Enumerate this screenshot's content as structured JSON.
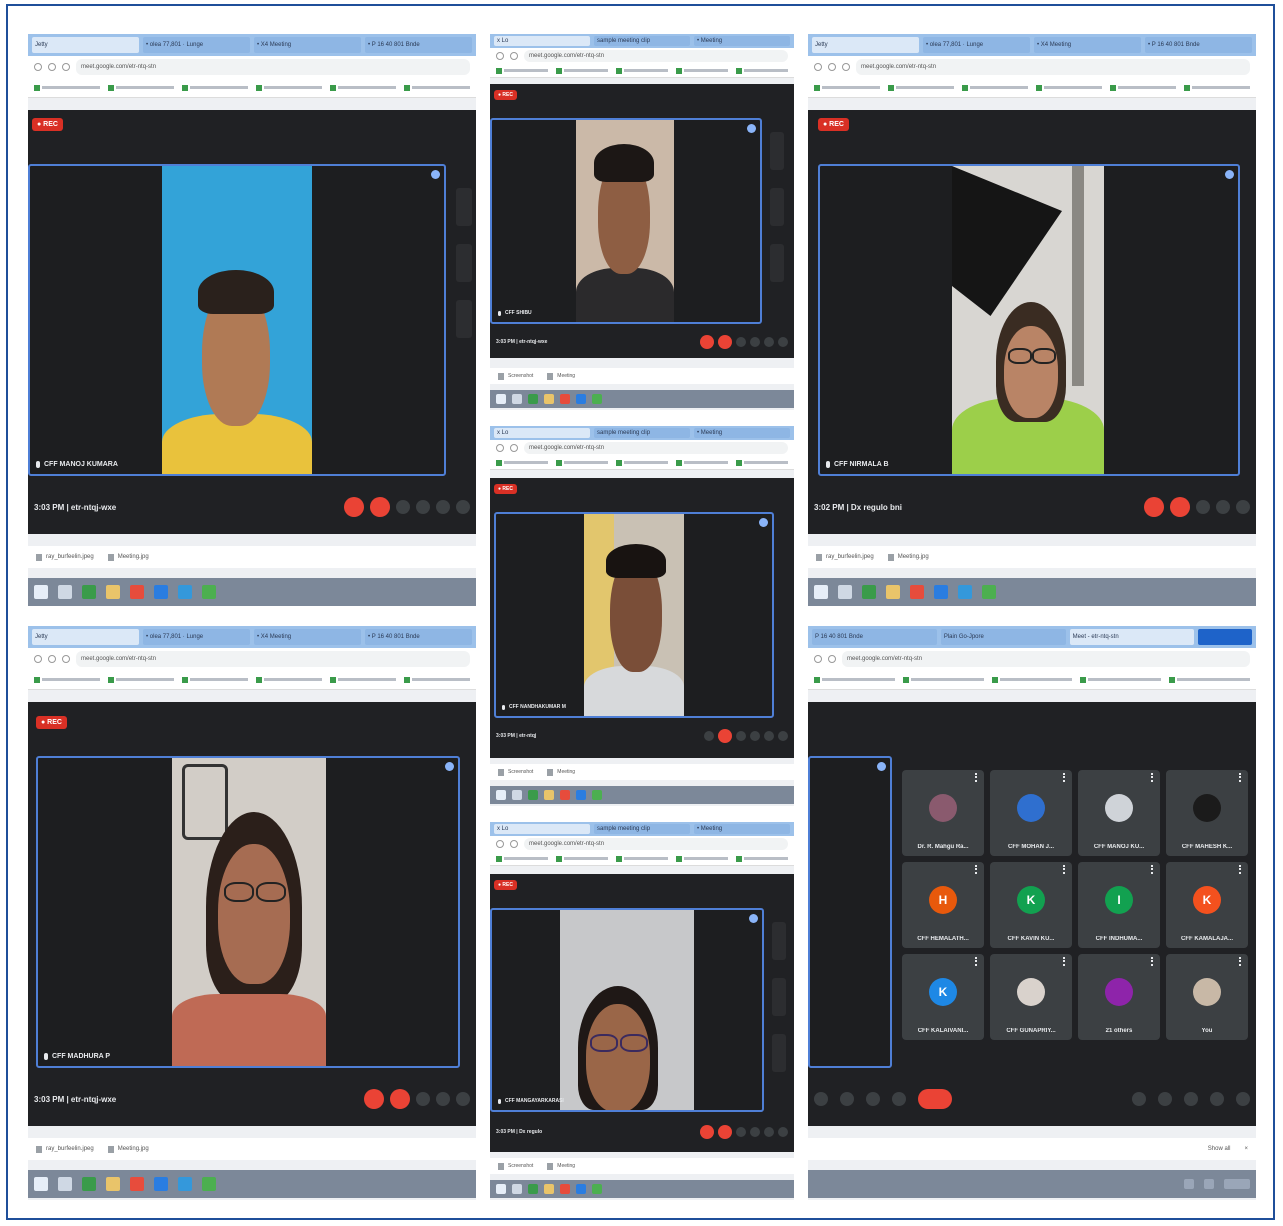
{
  "colors": {
    "border": "#1f4f9a",
    "meet_bg": "#202124",
    "tile_border": "#4f7fd6",
    "rec": "#d93025",
    "end_call": "#ea4335",
    "tab_bar": "#9cc1ea",
    "taskbar": "#7c8899"
  },
  "screenshots": [
    {
      "id": "shot-1",
      "tabs": [
        "Jetty",
        "• olea 77,801 · Lunge",
        "• X4 Meeting",
        "• P 16 40 801 Bnde"
      ],
      "url": "meet.google.com/etr-ntq-stn",
      "rec_label": "● REC",
      "participant": "CFF MANOJ KUMARA",
      "clock": "3:03 PM  |  etr-ntqj-wxe",
      "downloads": [
        "ray_burfeelin.jpeg",
        "Meeting.jpg"
      ]
    },
    {
      "id": "shot-2",
      "tabs": [
        "x Lo",
        "sample meeting clip",
        "• Meeting"
      ],
      "url": "meet.google.com/etr-ntq-stn",
      "rec_label": "● REC",
      "participant": "CFF SHIBU",
      "clock": "3:03 PM  |  etr-ntqj-wxe",
      "downloads": [
        "Screenshot",
        "Meeting"
      ]
    },
    {
      "id": "shot-3",
      "tabs": [
        "Jetty",
        "• olea 77,801 · Lunge",
        "• X4 Meeting",
        "• P 16 40 801 Bnde"
      ],
      "url": "meet.google.com/etr-ntq-stn",
      "rec_label": "● REC",
      "participant": "CFF NIRMALA B",
      "clock": "3:02 PM  |  Dx regulo bni",
      "downloads": [
        "ray_burfeelin.jpeg",
        "Meeting.jpg"
      ]
    },
    {
      "id": "shot-4",
      "tabs": [
        "x Lo",
        "sample meeting clip",
        "• Meeting"
      ],
      "url": "meet.google.com/etr-ntq-stn",
      "rec_label": "● REC",
      "participant": "CFF NANDHAKUMAR M",
      "clock": "3:03 PM  |  etr-ntqj",
      "downloads": [
        "Screenshot",
        "Meeting"
      ]
    },
    {
      "id": "shot-5",
      "tabs": [
        "Jetty",
        "• olea 77,801 · Lunge",
        "• X4 Meeting",
        "• P 16 40 801 Bnde"
      ],
      "url": "meet.google.com/etr-ntq-stn",
      "rec_label": "● REC",
      "participant": "CFF MADHURA P",
      "clock": "3:03 PM  |  etr-ntqj-wxe",
      "downloads": [
        "ray_burfeelin.jpeg",
        "Meeting.jpg"
      ]
    },
    {
      "id": "shot-6",
      "tabs": [
        "x Lo",
        "sample meeting clip",
        "• Meeting"
      ],
      "url": "meet.google.com/etr-ntq-stn",
      "rec_label": "● REC",
      "participant": "CFF MANGAYARKARASI",
      "clock": "3:03 PM  |  Dx regulo",
      "downloads": [
        "Screenshot",
        "Meeting"
      ]
    },
    {
      "id": "shot-7",
      "tabs": [
        "P 16 40 801 Bnde",
        "Plain Go-Jpore",
        "Meet - etr-ntq-stn"
      ],
      "url": "meet.google.com/etr-ntq-stn",
      "grid": [
        {
          "name": "Dr. R. Mahgu Ra...",
          "initial": "",
          "color": "#8a5a6e"
        },
        {
          "name": "CFF MOHAN J...",
          "initial": "",
          "color": "#2f6fcf"
        },
        {
          "name": "CFF MANOJ KU...",
          "initial": "",
          "color": "#cfd3d8"
        },
        {
          "name": "CFF MAHESH K...",
          "initial": "",
          "color": "#1b1b1b"
        },
        {
          "name": "CFF HEMALATH...",
          "initial": "H",
          "color": "#e8590c"
        },
        {
          "name": "CFF KAVIN KU...",
          "initial": "K",
          "color": "#12a150"
        },
        {
          "name": "CFF INDHUMA...",
          "initial": "I",
          "color": "#12a150"
        },
        {
          "name": "CFF KAMALAJA...",
          "initial": "K",
          "color": "#f4511e"
        },
        {
          "name": "CFF KALAIVANI...",
          "initial": "K",
          "color": "#1e88e5"
        },
        {
          "name": "CFF GUNAPRIY...",
          "initial": "",
          "color": "#d9d2cc"
        },
        {
          "name": "21 others",
          "initial": "",
          "color": "#8e24aa"
        },
        {
          "name": "You",
          "initial": "",
          "color": "#c8b8a6"
        }
      ],
      "downloads": [
        "Show all",
        "×"
      ]
    }
  ]
}
